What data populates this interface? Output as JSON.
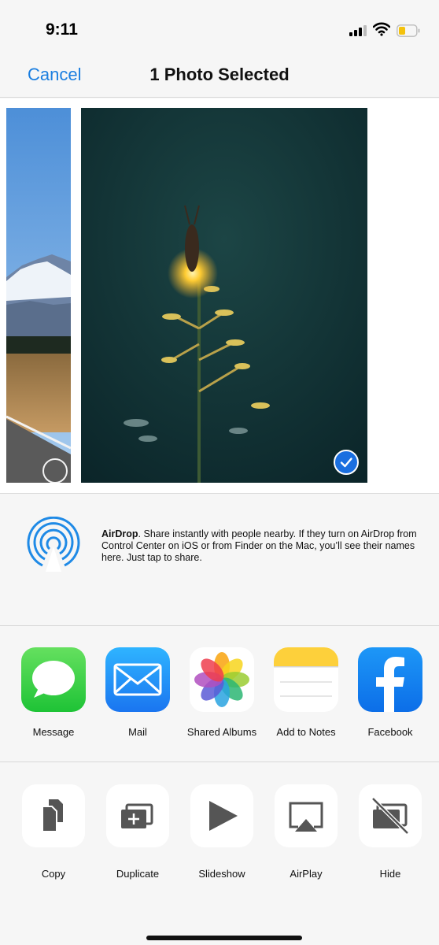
{
  "status_bar": {
    "time": "9:11"
  },
  "nav": {
    "cancel_label": "Cancel",
    "title": "1 Photo Selected"
  },
  "airdrop": {
    "title": "AirDrop",
    "description": ". Share instantly with people nearby. If they turn on AirDrop from Control Center on iOS or from Finder on the Mac, you’ll see their names here. Just tap to share."
  },
  "apps": [
    {
      "label": "Message",
      "icon": "messages-icon"
    },
    {
      "label": "Mail",
      "icon": "mail-icon"
    },
    {
      "label": "Shared Albums",
      "icon": "photos-icon"
    },
    {
      "label": "Add to Notes",
      "icon": "notes-icon"
    },
    {
      "label": "Facebook",
      "icon": "facebook-icon"
    }
  ],
  "actions": [
    {
      "label": "Copy",
      "icon": "copy-icon"
    },
    {
      "label": "Duplicate",
      "icon": "duplicate-icon"
    },
    {
      "label": "Slideshow",
      "icon": "play-icon"
    },
    {
      "label": "AirPlay",
      "icon": "airplay-icon"
    },
    {
      "label": "Hide",
      "icon": "hide-icon"
    }
  ],
  "colors": {
    "accent": "#1a7ee0",
    "battery": "#f4c20d",
    "selected": "#1a6fe0"
  }
}
